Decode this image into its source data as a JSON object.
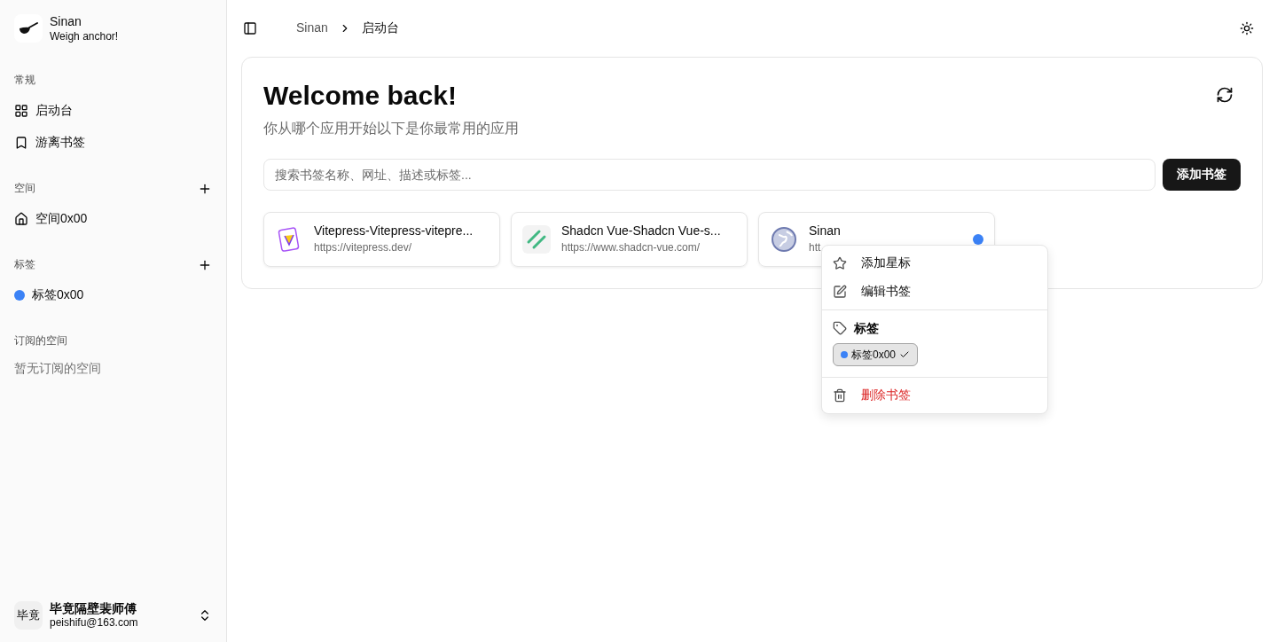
{
  "app": {
    "name": "Sinan",
    "tagline": "Weigh anchor!"
  },
  "sidebar": {
    "sections": [
      {
        "title": "常规",
        "kind": "nav",
        "items": [
          {
            "label": "启动台"
          },
          {
            "label": "游离书签"
          }
        ]
      },
      {
        "title": "空间",
        "kind": "spaces",
        "items": [
          {
            "label": "空间0x00"
          }
        ]
      },
      {
        "title": "标签",
        "kind": "tags",
        "items": [
          {
            "label": "标签0x00",
            "color": "#3b82f6"
          }
        ]
      },
      {
        "title": "订阅的空间",
        "kind": "empty",
        "empty_text": "暂无订阅的空间"
      }
    ]
  },
  "user": {
    "avatar_text": "毕竟",
    "name": "毕竟隔壁裴师傅",
    "email": "peishifu@163.com"
  },
  "breadcrumb": [
    "Sinan",
    "启动台"
  ],
  "welcome": {
    "title": "Welcome back!",
    "subtitle": "你从哪个应用开始以下是你最常用的应用"
  },
  "search": {
    "placeholder": "搜索书签名称、网址、描述或标签..."
  },
  "add_button": "添加书签",
  "bookmarks": [
    {
      "title": "Vitepress-Vitepress-vitepre...",
      "url": "https://vitepress.dev/"
    },
    {
      "title": "Shadcn Vue-Shadcn Vue-s...",
      "url": "https://www.shadcn-vue.com/"
    },
    {
      "title": "Sinan",
      "url": "htt",
      "color": "#3b82f6"
    }
  ],
  "context_menu": {
    "items": [
      {
        "label": "添加星标"
      },
      {
        "label": "编辑书签"
      }
    ],
    "tags_title": "标签",
    "tags": [
      {
        "label": "标签0x00",
        "color": "#3b82f6",
        "checked": true
      }
    ],
    "danger": {
      "label": "删除书签"
    }
  }
}
